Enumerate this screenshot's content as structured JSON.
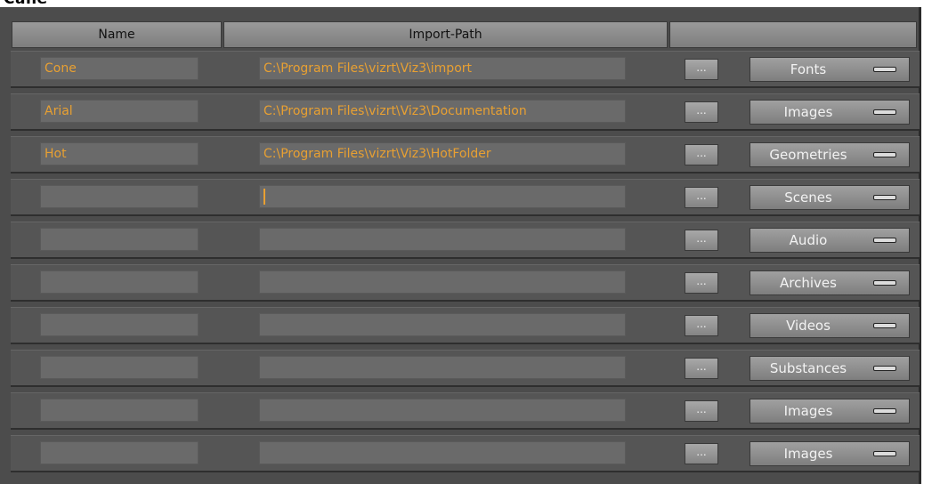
{
  "window": {
    "title": "Cane"
  },
  "columns": {
    "name": "Name",
    "path": "Import-Path",
    "extra": ""
  },
  "browse_label": "...",
  "rows": [
    {
      "name": "Cone",
      "path": "C:\\Program Files\\vizrt\\Viz3\\import",
      "type": "Fonts"
    },
    {
      "name": "Arial",
      "path": "C:\\Program Files\\vizrt\\Viz3\\Documentation",
      "type": "Images"
    },
    {
      "name": "Hot",
      "path": "C:\\Program Files\\vizrt\\Viz3\\HotFolder",
      "type": "Geometries"
    },
    {
      "name": "",
      "path": "",
      "type": "Scenes"
    },
    {
      "name": "",
      "path": "",
      "type": "Audio"
    },
    {
      "name": "",
      "path": "",
      "type": "Archives"
    },
    {
      "name": "",
      "path": "",
      "type": "Videos"
    },
    {
      "name": "",
      "path": "",
      "type": "Substances"
    },
    {
      "name": "",
      "path": "",
      "type": "Images"
    },
    {
      "name": "",
      "path": "",
      "type": "Images"
    }
  ],
  "colors": {
    "text_accent": "#e8a032",
    "panel_bg": "#4c4c4c"
  },
  "icons": {
    "dropdown": "dropdown-bar-icon"
  }
}
